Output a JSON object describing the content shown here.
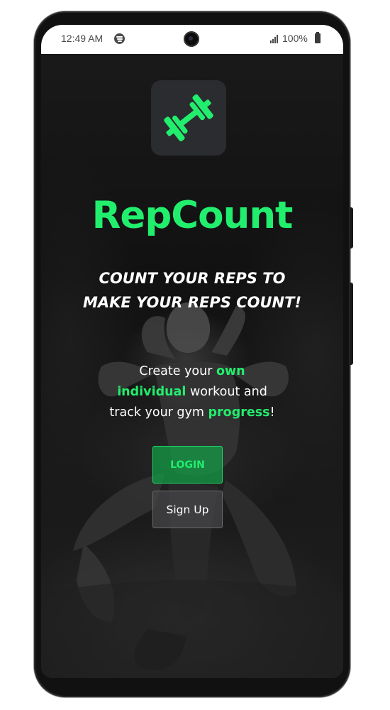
{
  "status_bar": {
    "time": "12:49 AM",
    "battery": "100%",
    "icons": [
      "spotify-icon",
      "signal-icon",
      "battery-icon"
    ]
  },
  "app": {
    "name": "RepCount",
    "logo_icon": "dumbbell-icon",
    "tagline_line1": "COUNT YOUR REPS TO",
    "tagline_line2": "MAKE YOUR REPS COUNT!",
    "description": {
      "part1": "Create your ",
      "hl1": "own",
      "hl2": "individual",
      "part2": " workout and",
      "part3": "track your gym ",
      "hl3": "progress",
      "part4": "!"
    }
  },
  "buttons": {
    "login": "LOGIN",
    "signup": "Sign Up"
  },
  "colors": {
    "accent": "#22ee6e",
    "logo_tile": "#2b2c2f",
    "background": "#1b1b1b"
  }
}
